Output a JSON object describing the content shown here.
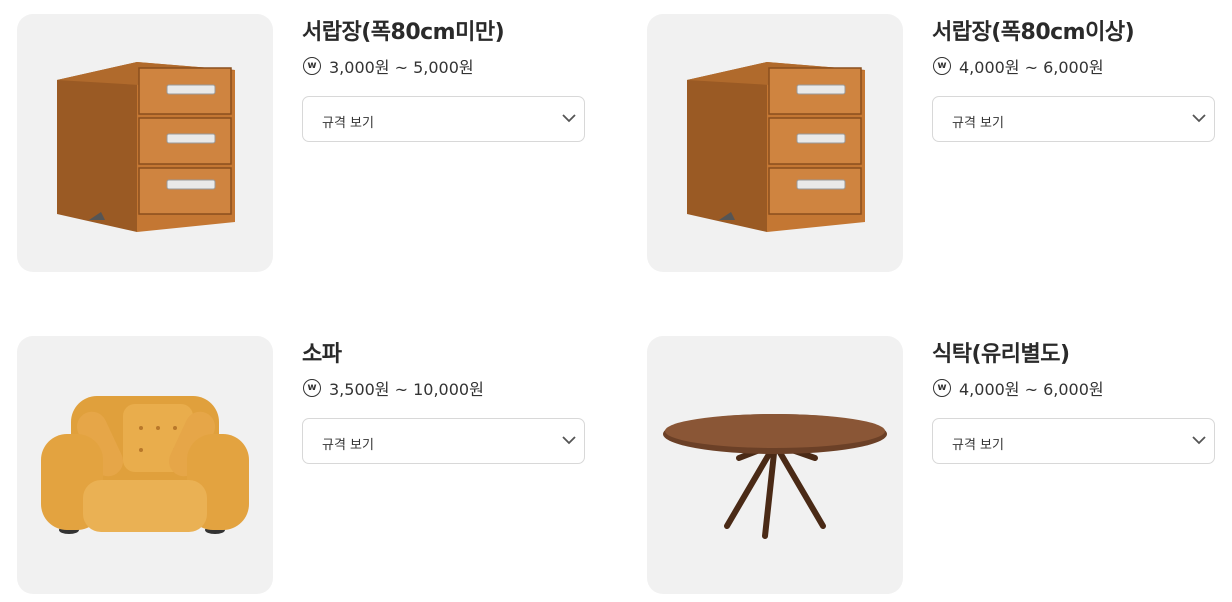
{
  "products": [
    {
      "title": "서랍장(폭80cm미만)",
      "price": "3,000원 ~ 5,000원",
      "select_label": "규격 보기",
      "image": "drawer-chest"
    },
    {
      "title": "서랍장(폭80cm이상)",
      "price": "4,000원 ~ 6,000원",
      "select_label": "규격 보기",
      "image": "drawer-chest"
    },
    {
      "title": "소파",
      "price": "3,500원 ~ 10,000원",
      "select_label": "규격 보기",
      "image": "sofa"
    },
    {
      "title": "식탁(유리별도)",
      "price": "4,000원 ~ 6,000원",
      "select_label": "규격 보기",
      "image": "round-table"
    }
  ],
  "currency_icon": "won-icon",
  "currency_symbol": "w",
  "colors": {
    "thumb_bg": "#f1f1f1",
    "wood": "#c87a35",
    "sofa": "#e4a23d",
    "table_wood": "#6b4027"
  }
}
